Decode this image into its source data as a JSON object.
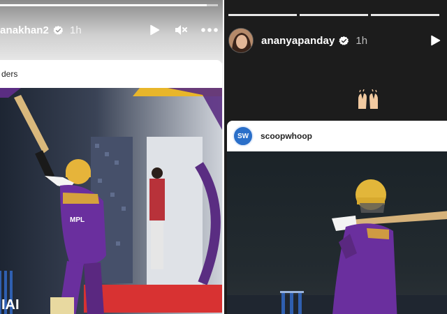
{
  "left_story": {
    "username": "anakhan2",
    "time": "1h",
    "progress": 0.95,
    "card": {
      "source_text": "ders"
    },
    "overlay_text": "IAI"
  },
  "right_story": {
    "username": "ananyapanday",
    "time": "1h",
    "progress_segments": 3,
    "card": {
      "logo_text": "SW",
      "account": "scoopwhoop"
    }
  },
  "colors": {
    "kkr_purple": "#5a2d82",
    "kkr_gold": "#e8b62a",
    "verified_blue": "#ffffff",
    "sw_blue": "#2a6fc9"
  },
  "icons": [
    "verified-icon",
    "play-icon",
    "mute-icon",
    "more-icon",
    "raising-hands-emoji"
  ]
}
